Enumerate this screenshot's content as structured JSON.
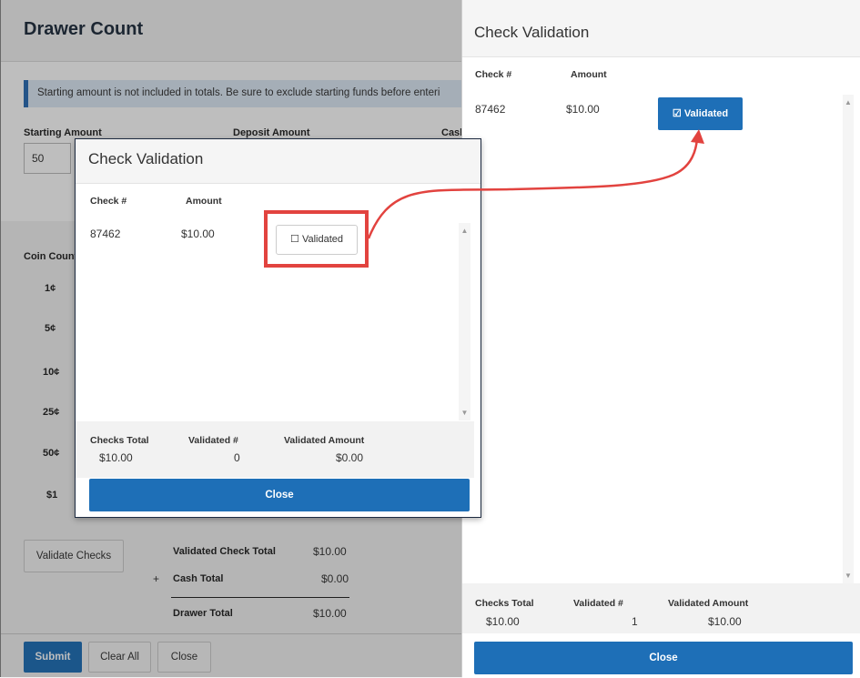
{
  "drawer": {
    "title": "Drawer Count",
    "banner": "Starting amount is not included in totals. Be sure to exclude starting funds before enteri",
    "fields": {
      "starting_amount_label": "Starting Amount",
      "starting_amount_value": "50",
      "deposit_amount_label": "Deposit Amount",
      "cash_label": "Cash"
    },
    "coin_count_label": "Coin Count",
    "coins": [
      "1¢",
      "5¢",
      "10¢",
      "25¢",
      "50¢",
      "$1"
    ],
    "validate_checks_label": "Validate Checks",
    "totals": {
      "validated_check_total_label": "Validated Check Total",
      "validated_check_total_value": "$10.00",
      "plus": "+",
      "cash_total_label": "Cash Total",
      "cash_total_value": "$0.00",
      "drawer_total_label": "Drawer Total",
      "drawer_total_value": "$10.00"
    },
    "footer": {
      "submit": "Submit",
      "clear_all": "Clear All",
      "close": "Close"
    }
  },
  "dialog": {
    "title": "Check Validation",
    "columns": {
      "check": "Check #",
      "amount": "Amount"
    },
    "row": {
      "check": "87462",
      "amount": "$10.00",
      "status": "Validated",
      "checkbox": "☐"
    },
    "summary": {
      "checks_total_label": "Checks Total",
      "checks_total_value": "$10.00",
      "validated_count_label": "Validated #",
      "validated_count_value": "0",
      "validated_amount_label": "Validated Amount",
      "validated_amount_value": "$0.00"
    },
    "close": "Close"
  },
  "panel": {
    "title": "Check Validation",
    "columns": {
      "check": "Check #",
      "amount": "Amount"
    },
    "row": {
      "check": "87462",
      "amount": "$10.00",
      "status": "Validated",
      "checkbox": "☑"
    },
    "summary": {
      "checks_total_label": "Checks Total",
      "checks_total_value": "$10.00",
      "validated_count_label": "Validated #",
      "validated_count_value": "1",
      "validated_amount_label": "Validated Amount",
      "validated_amount_value": "$10.00"
    },
    "close": "Close"
  },
  "colors": {
    "accent": "#1e6fb7",
    "highlight": "#e2433f",
    "dialog_border": "#1d2a40"
  },
  "icons": [
    "checkbox-empty-icon",
    "checkbox-checked-icon",
    "scroll-up-icon",
    "scroll-down-icon",
    "annotation-arrow-icon"
  ]
}
